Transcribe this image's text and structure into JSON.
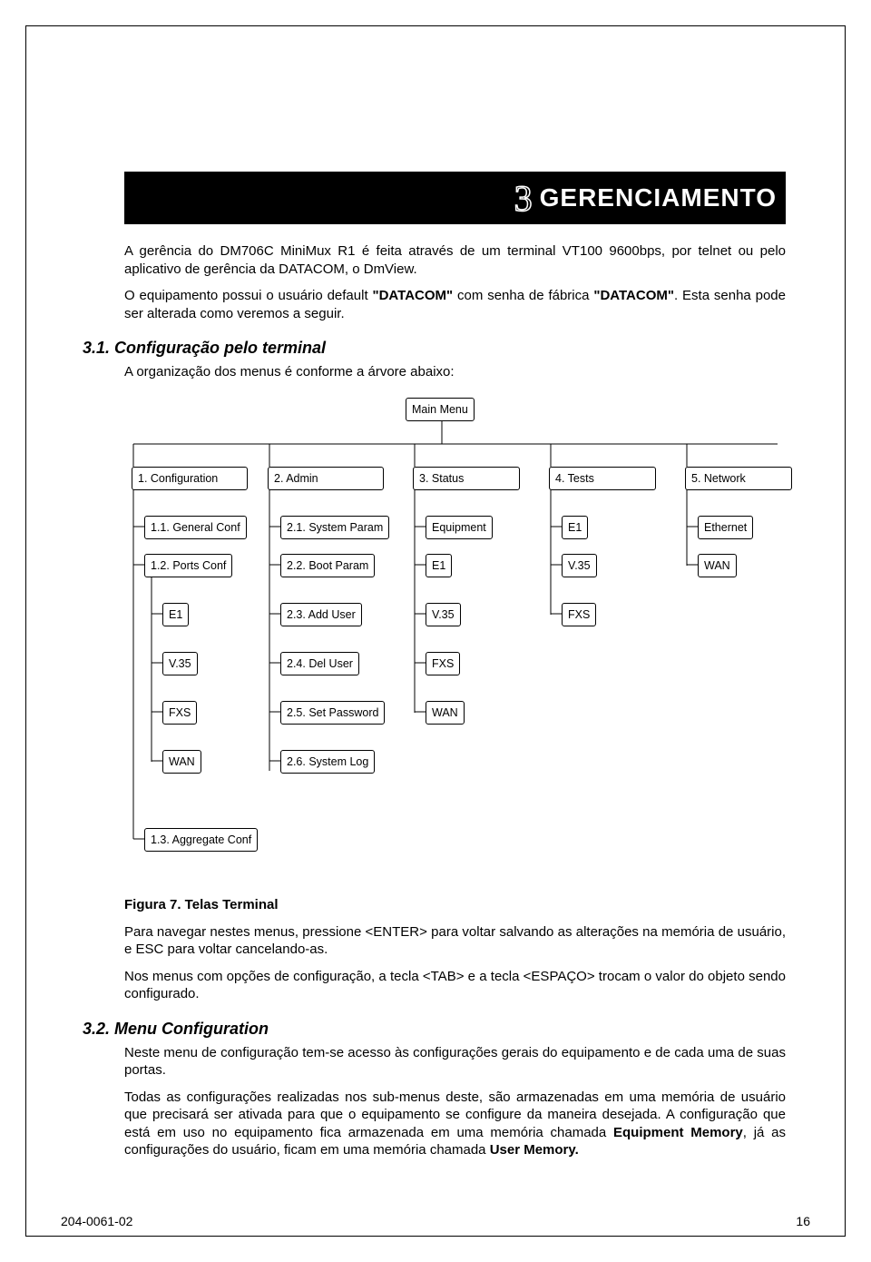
{
  "chapter": {
    "number": "3",
    "title": "GERENCIAMENTO"
  },
  "intro": {
    "p1a": "A gerência do DM706C MiniMux R1 é feita através de um terminal VT100 9600bps, por telnet ou pelo aplicativo de gerência da DATACOM, o DmView.",
    "p2a": "O equipamento possui o usuário default ",
    "p2b": "\"DATACOM\"",
    "p2c": " com senha de fábrica ",
    "p2d": "\"DATACOM\"",
    "p2e": ". Esta senha pode ser alterada como veremos a seguir."
  },
  "sections": {
    "s31": {
      "heading": "3.1. Configuração pelo terminal",
      "lead": "A organização dos menus é conforme a árvore abaixo:"
    },
    "s32": {
      "heading": "3.2. Menu Configuration"
    }
  },
  "tree": {
    "root": "Main Menu",
    "col0": {
      "head": "1. Configuration",
      "items": [
        "1.1. General Conf",
        "1.2. Ports Conf",
        "E1",
        "V.35",
        "FXS",
        "WAN",
        "1.3. Aggregate Conf"
      ]
    },
    "col1": {
      "head": "2. Admin",
      "items": [
        "2.1. System Param",
        "2.2. Boot Param",
        "2.3. Add User",
        "2.4. Del User",
        "2.5. Set Password",
        "2.6. System Log"
      ]
    },
    "col2": {
      "head": "3. Status",
      "items": [
        "Equipment",
        "E1",
        "V.35",
        "FXS",
        "WAN"
      ]
    },
    "col3": {
      "head": "4. Tests",
      "items": [
        "E1",
        "V.35",
        "FXS"
      ]
    },
    "col4": {
      "head": "5. Network",
      "items": [
        "Ethernet",
        "WAN"
      ]
    }
  },
  "figure": {
    "caption": "Figura 7. Telas Terminal"
  },
  "after_fig": {
    "p1": "Para navegar nestes menus, pressione <ENTER> para voltar salvando as alterações na memória de usuário, e ESC para voltar cancelando-as.",
    "p2": "Nos menus com opções de configuração, a tecla <TAB> e a tecla <ESPAÇO> trocam o valor do objeto sendo configurado."
  },
  "s32_body": {
    "p1": "Neste menu de configuração tem-se acesso às configurações gerais do equipamento e de cada uma de suas portas.",
    "p2a": "Todas as configurações realizadas nos sub-menus deste, são armazenadas em uma memória de usuário que precisará ser ativada para que o equipamento se configure da maneira desejada. A configuração que está em uso no equipamento fica armazenada em uma memória chamada ",
    "p2b": "Equipment Memory",
    "p2c": ", já as configurações do usuário, ficam em ",
    "p2d": "uma memória chamada ",
    "p2e": "User Memory."
  },
  "footer": {
    "left": "204-0061-02",
    "right": "16"
  }
}
